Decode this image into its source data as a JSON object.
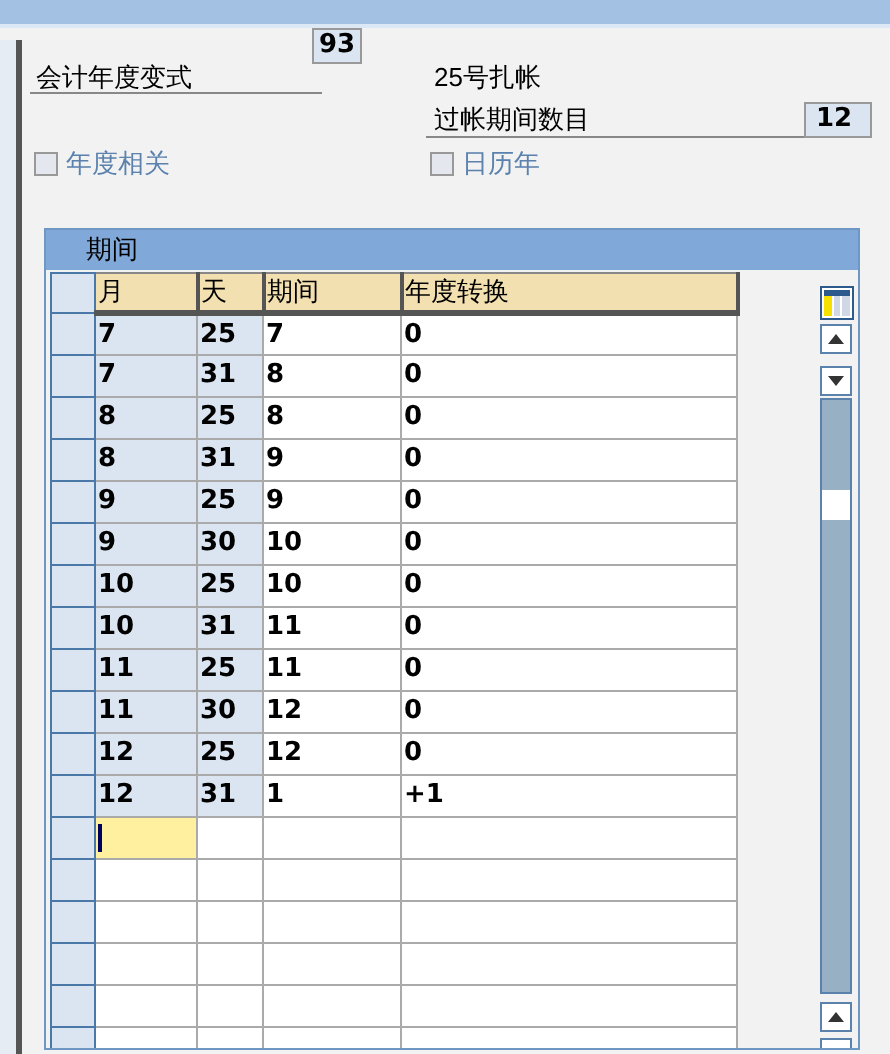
{
  "fields": [
    {
      "label": "会计年度变式",
      "value": "93"
    },
    {
      "label": "25号扎帐"
    },
    {
      "label": "过帐期间数目",
      "value": "12"
    }
  ],
  "checkboxes": [
    {
      "label": "年度相关",
      "checked": false
    },
    {
      "label": "日历年",
      "checked": false
    }
  ],
  "table": {
    "title": "期间",
    "columns": [
      "月",
      "天",
      "期间",
      "年度转换"
    ],
    "rows": [
      {
        "kind": "data",
        "cells": [
          "7",
          "25",
          "7",
          "0"
        ]
      },
      {
        "kind": "data",
        "cells": [
          "7",
          "31",
          "8",
          "0"
        ]
      },
      {
        "kind": "data",
        "cells": [
          "8",
          "25",
          "8",
          "0"
        ]
      },
      {
        "kind": "data",
        "cells": [
          "8",
          "31",
          "9",
          "0"
        ]
      },
      {
        "kind": "data",
        "cells": [
          "9",
          "25",
          "9",
          "0"
        ]
      },
      {
        "kind": "data",
        "cells": [
          "9",
          "30",
          "10",
          "0"
        ]
      },
      {
        "kind": "data",
        "cells": [
          "10",
          "25",
          "10",
          "0"
        ]
      },
      {
        "kind": "data",
        "cells": [
          "10",
          "31",
          "11",
          "0"
        ]
      },
      {
        "kind": "data",
        "cells": [
          "11",
          "25",
          "11",
          "0"
        ]
      },
      {
        "kind": "data",
        "cells": [
          "11",
          "30",
          "12",
          "0"
        ]
      },
      {
        "kind": "data",
        "cells": [
          "12",
          "25",
          "12",
          "0"
        ]
      },
      {
        "kind": "data",
        "cells": [
          "12",
          "31",
          "1",
          "+1"
        ]
      },
      {
        "kind": "empty",
        "focused": true
      },
      {
        "kind": "empty",
        "focused": false
      },
      {
        "kind": "empty",
        "focused": false
      },
      {
        "kind": "empty",
        "focused": false
      },
      {
        "kind": "empty",
        "focused": false
      },
      {
        "kind": "empty",
        "focused": false
      }
    ]
  }
}
